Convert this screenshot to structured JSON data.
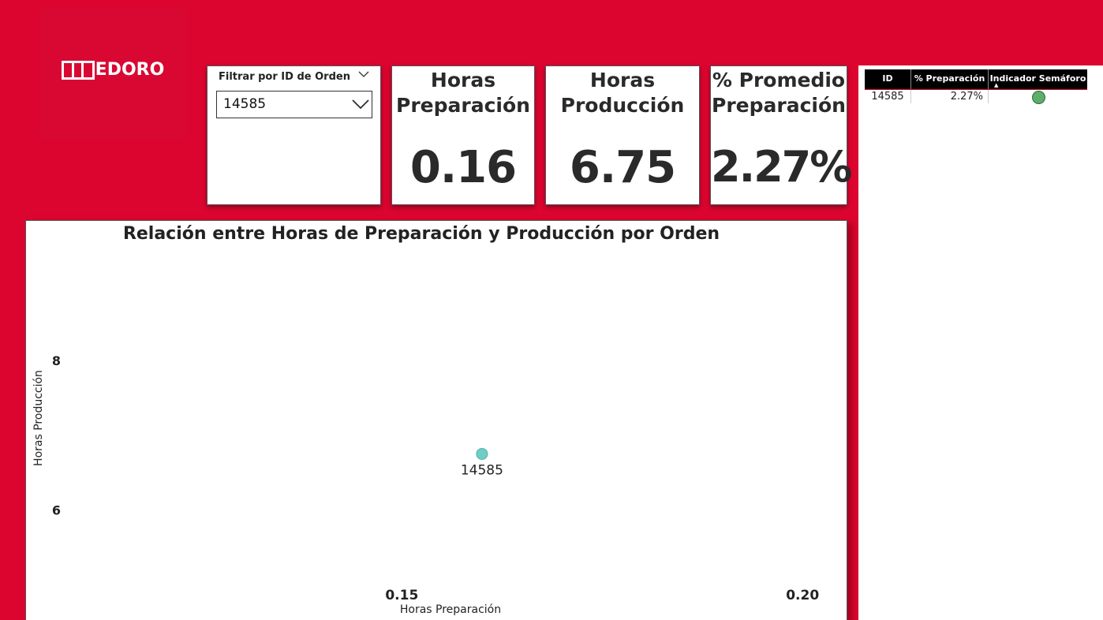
{
  "logo": {
    "text": "EDORO"
  },
  "slicer": {
    "title": "Filtrar por ID de Orden",
    "selected": "14585"
  },
  "kpis": [
    {
      "title": "Horas Preparación",
      "value": "0.16"
    },
    {
      "title": "Horas Producción",
      "value": "6.75"
    },
    {
      "title": "% Promedio Preparación",
      "value": "2.27%"
    }
  ],
  "table": {
    "headers": [
      "ID",
      "% Preparación",
      "Indicador Semáforo"
    ],
    "rows": [
      {
        "id": "14585",
        "pct": "2.27%",
        "indicator": "green"
      }
    ],
    "indicator_color": "#5cae6a"
  },
  "chart_data": {
    "type": "scatter",
    "title": "Relación entre Horas de Preparación y Producción por Orden",
    "xlabel": "Horas Preparación",
    "ylabel": "Horas Producción",
    "xticks": [
      0.15,
      0.2
    ],
    "yticks": [
      6,
      8
    ],
    "xlim": [
      0.11,
      0.205
    ],
    "ylim": [
      4.8,
      9.45
    ],
    "points": [
      {
        "x": 0.16,
        "y": 6.75,
        "label": "14585"
      }
    ],
    "point_color": "#6fcdc4",
    "grid": false
  },
  "colors": {
    "background": "#dc0530",
    "panel": "#ffffff",
    "text": "#2a2a2a"
  }
}
